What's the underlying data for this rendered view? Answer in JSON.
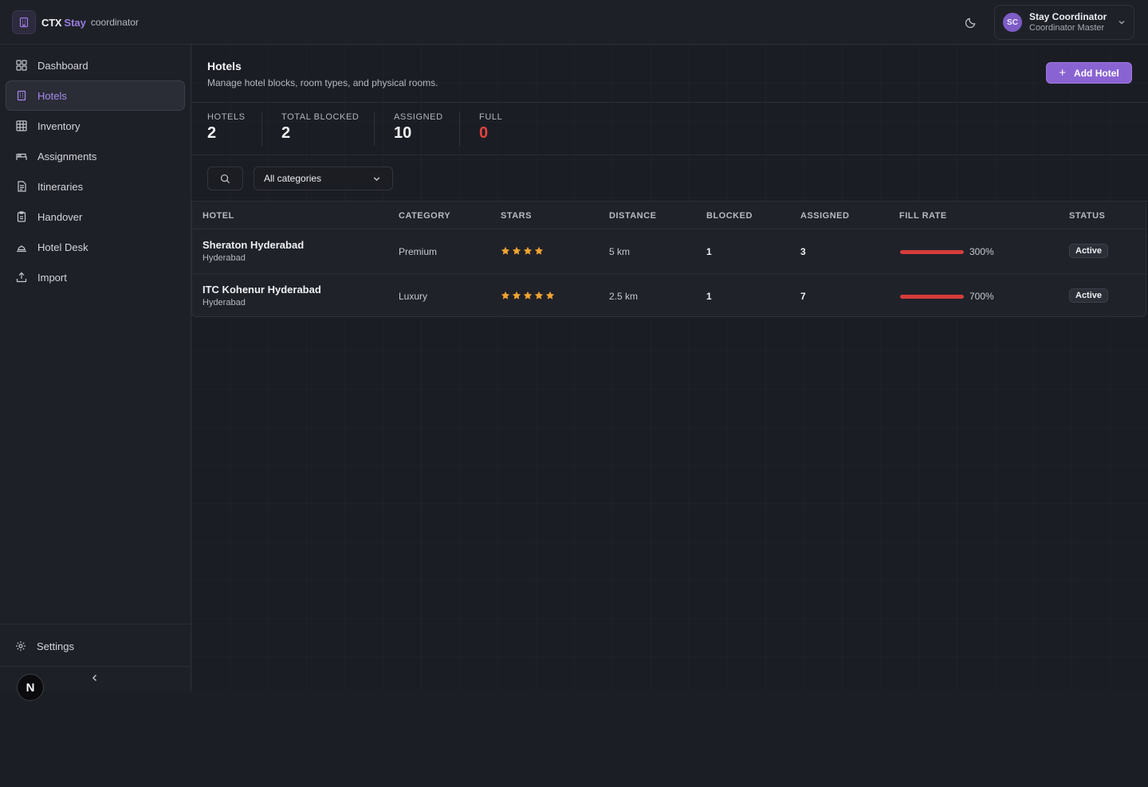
{
  "brand": {
    "ctx": "CTX",
    "stay": "Stay",
    "role": "coordinator"
  },
  "user": {
    "initials": "SC",
    "name": "Stay Coordinator",
    "role": "Coordinator Master"
  },
  "sidebar": {
    "items": [
      {
        "label": "Dashboard",
        "icon": "dashboard-icon"
      },
      {
        "label": "Hotels",
        "icon": "building-icon",
        "active": true
      },
      {
        "label": "Inventory",
        "icon": "grid-icon"
      },
      {
        "label": "Assignments",
        "icon": "bed-icon"
      },
      {
        "label": "Itineraries",
        "icon": "document-icon"
      },
      {
        "label": "Handover",
        "icon": "clipboard-icon"
      },
      {
        "label": "Hotel Desk",
        "icon": "bell-icon"
      },
      {
        "label": "Import",
        "icon": "upload-icon"
      }
    ],
    "settings_label": "Settings",
    "badge_letter": "N"
  },
  "page": {
    "title": "Hotels",
    "subtitle": "Manage hotel blocks, room types, and physical rooms.",
    "add_button": "Add Hotel"
  },
  "stats": [
    {
      "label": "HOTELS",
      "value": "2"
    },
    {
      "label": "TOTAL BLOCKED",
      "value": "2"
    },
    {
      "label": "ASSIGNED",
      "value": "10"
    },
    {
      "label": "FULL",
      "value": "0",
      "color": "#e0443e"
    }
  ],
  "filters": {
    "category": "All categories"
  },
  "table": {
    "headers": [
      "HOTEL",
      "CATEGORY",
      "STARS",
      "DISTANCE",
      "BLOCKED",
      "ASSIGNED",
      "FILL RATE",
      "STATUS"
    ],
    "rows": [
      {
        "name": "Sheraton Hyderabad",
        "city": "Hyderabad",
        "category": "Premium",
        "stars": 4,
        "distance": "5 km",
        "blocked": "1",
        "assigned": "3",
        "fill_rate": "300%",
        "fill_fraction": 1.0,
        "status": "Active"
      },
      {
        "name": "ITC Kohenur Hyderabad",
        "city": "Hyderabad",
        "category": "Luxury",
        "stars": 5,
        "distance": "2.5 km",
        "blocked": "1",
        "assigned": "7",
        "fill_rate": "700%",
        "fill_fraction": 1.0,
        "status": "Active"
      }
    ]
  },
  "colors": {
    "accent": "#8a63d2",
    "danger": "#d63c3a",
    "star": "#f0a431"
  }
}
